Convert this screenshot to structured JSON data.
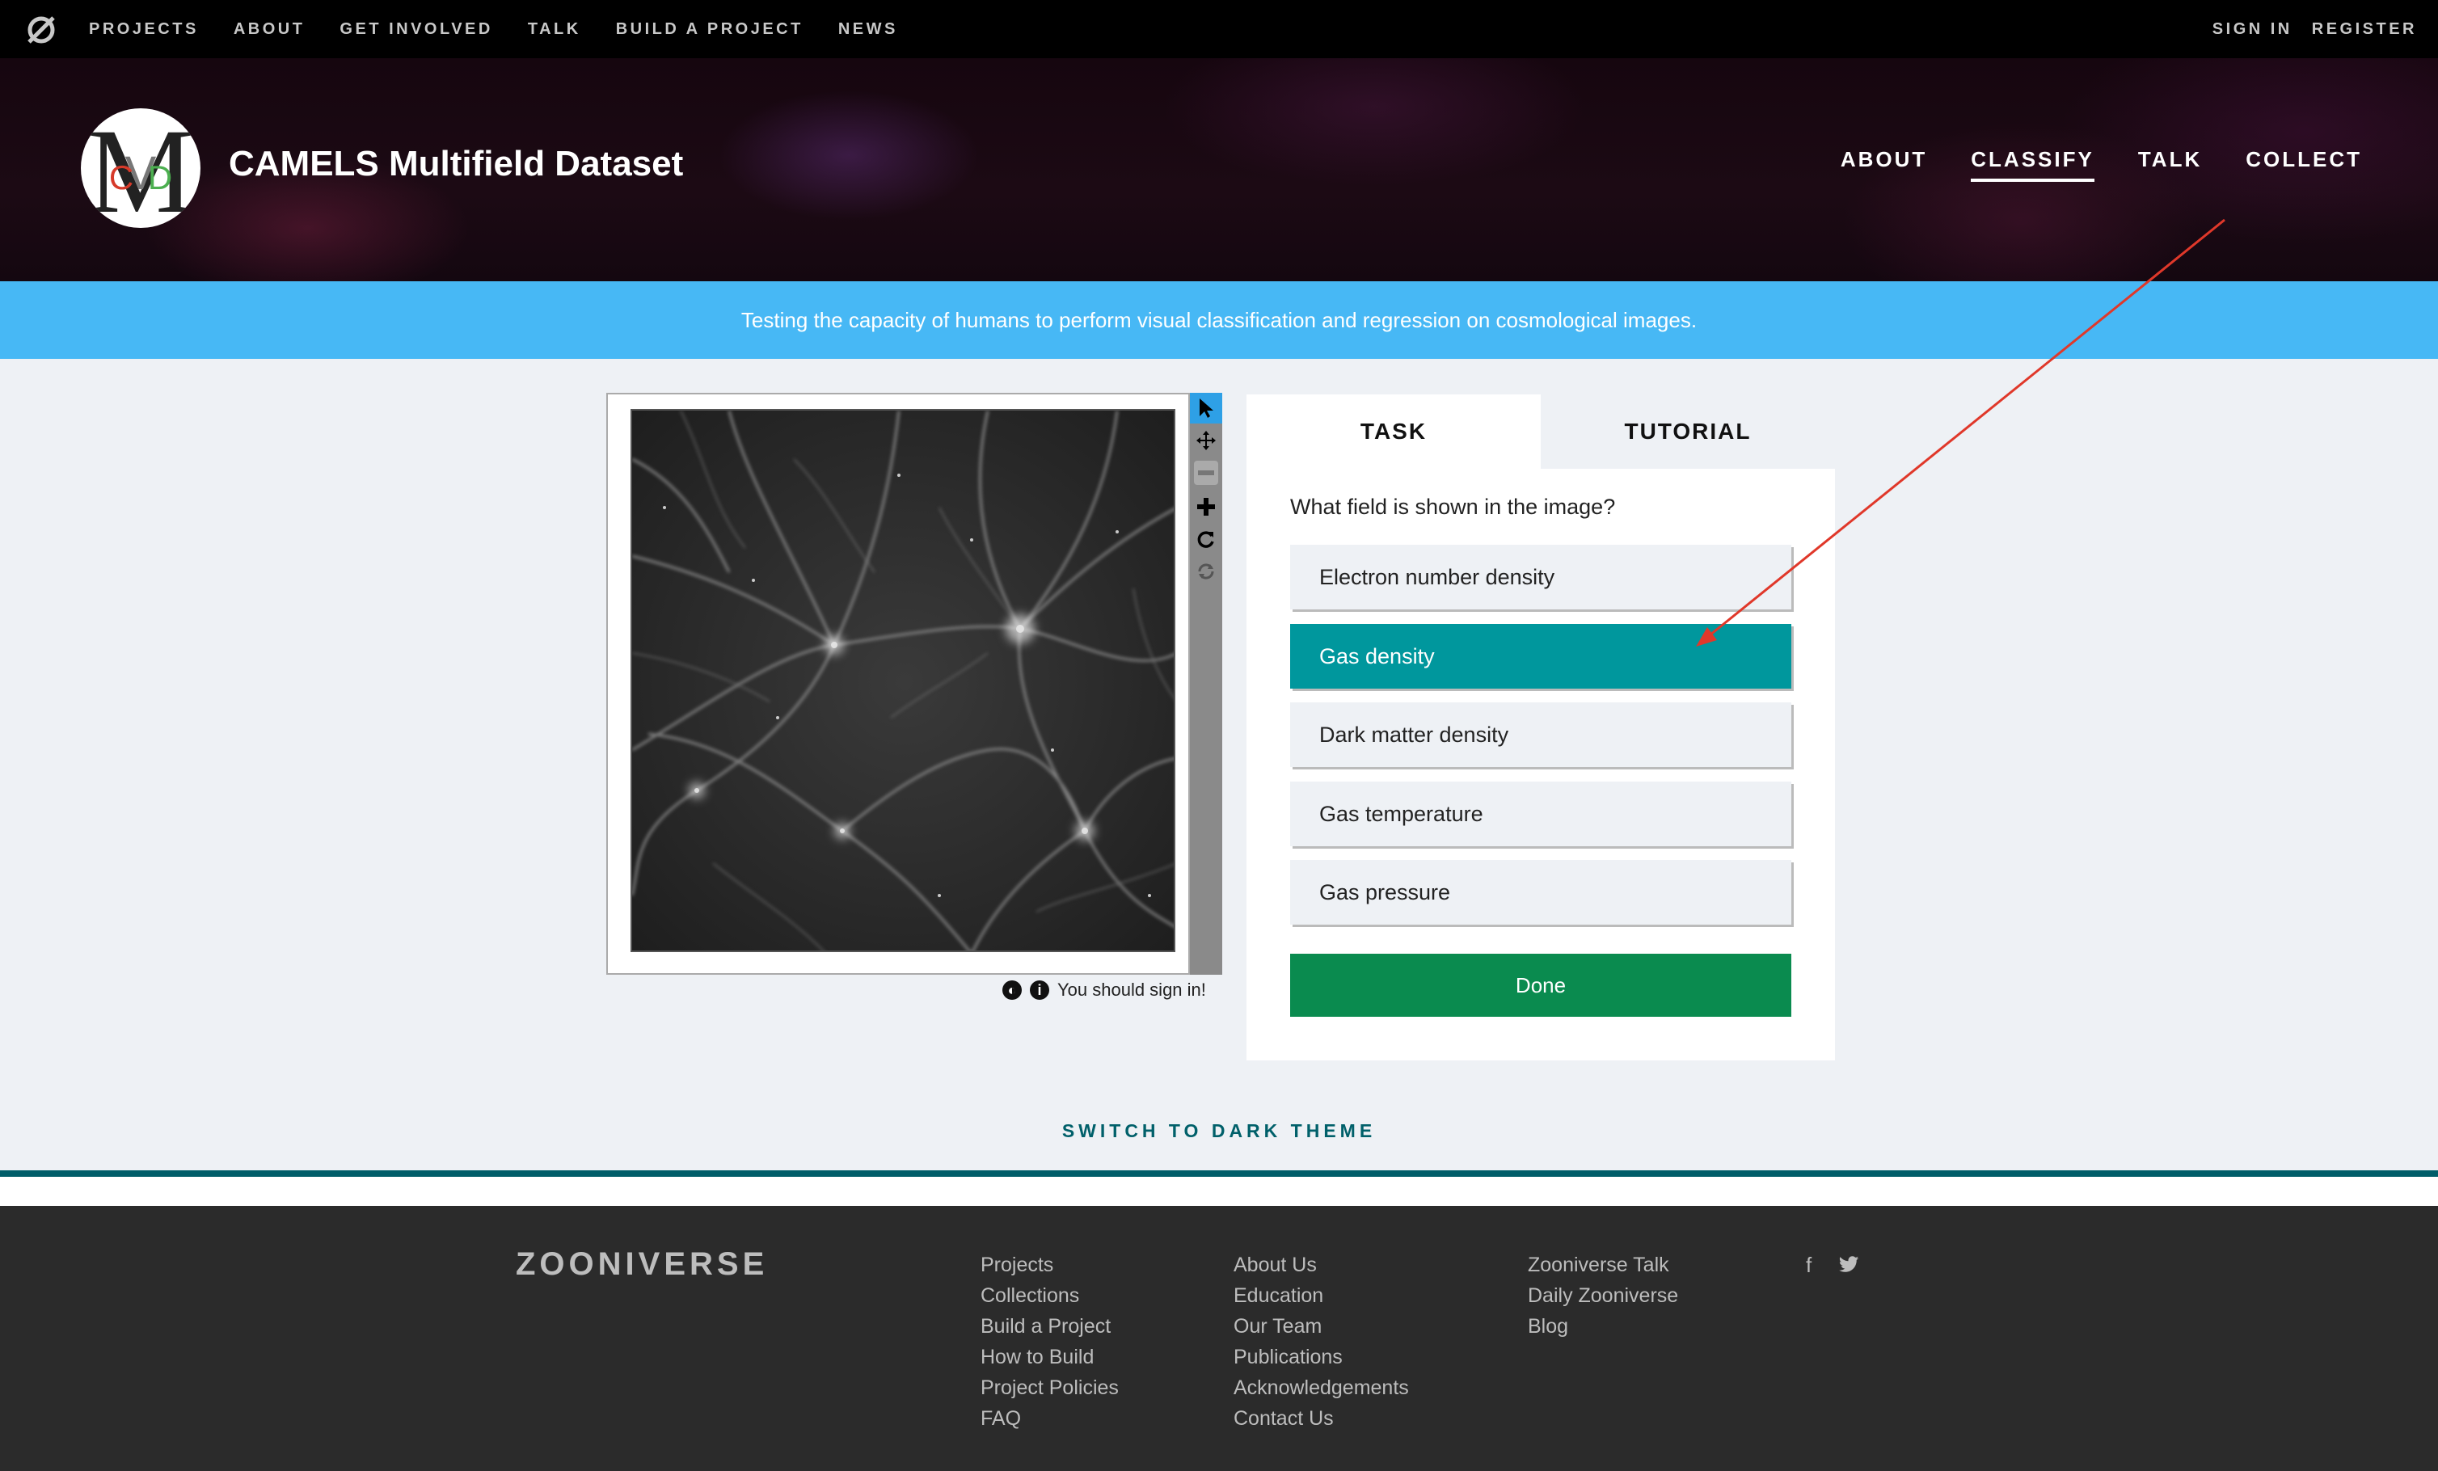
{
  "topnav": {
    "links": [
      "PROJECTS",
      "ABOUT",
      "GET INVOLVED",
      "TALK",
      "BUILD A PROJECT",
      "NEWS"
    ],
    "sign_in": "SIGN IN",
    "register": "REGISTER"
  },
  "project": {
    "title": "CAMELS Multifield Dataset",
    "nav": [
      "ABOUT",
      "CLASSIFY",
      "TALK",
      "COLLECT"
    ],
    "active_nav": "CLASSIFY",
    "avatar_letters": {
      "main": "M",
      "left": "C",
      "center": "V",
      "right": "D"
    }
  },
  "banner": {
    "text": "Testing the capacity of humans to perform visual classification and regression on cosmological images."
  },
  "viewer": {
    "tools": [
      "pointer-icon",
      "pan-icon",
      "zoom-out-icon",
      "zoom-in-icon",
      "rotate-icon",
      "reset-icon"
    ],
    "status_text": "You should sign in!"
  },
  "task": {
    "tabs": [
      "TASK",
      "TUTORIAL"
    ],
    "question": "What field is shown in the image?",
    "answers": [
      "Electron number density",
      "Gas density",
      "Dark matter density",
      "Gas temperature",
      "Gas pressure"
    ],
    "selected_answer": "Gas density",
    "done_label": "Done"
  },
  "theme_switch": "SWITCH TO DARK THEME",
  "footer": {
    "brand": "ZOONIVERSE",
    "col1": [
      "Projects",
      "Collections",
      "Build a Project",
      "How to Build",
      "Project Policies",
      "FAQ"
    ],
    "col2": [
      "About Us",
      "Education",
      "Our Team",
      "Publications",
      "Acknowledgements",
      "Contact Us"
    ],
    "col3": [
      "Zooniverse Talk",
      "Daily Zooniverse",
      "Blog"
    ],
    "social": [
      "facebook-icon",
      "twitter-icon"
    ]
  },
  "colors": {
    "banner": "#47b8f5",
    "selected_answer": "#00979d",
    "done_button": "#0a8b4f",
    "theme_link": "#00606a",
    "annotation_arrow": "#e0382a"
  }
}
